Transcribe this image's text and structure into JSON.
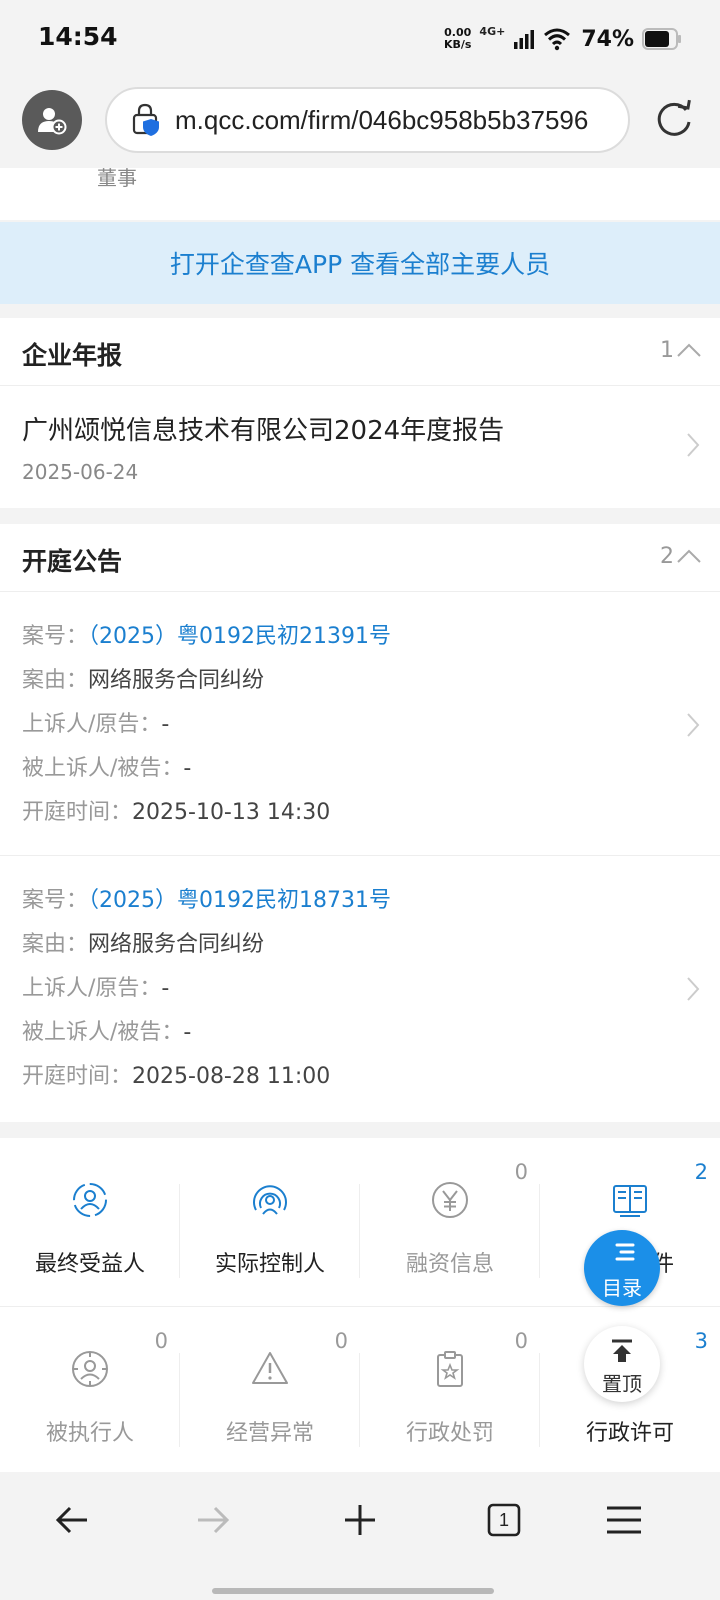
{
  "status": {
    "time": "14:54",
    "net_speed_value": "0.00",
    "net_speed_unit": "KB/s",
    "network": "4G+",
    "battery": "74%"
  },
  "browser": {
    "url": "m.qcc.com/firm/046bc958b5b37596"
  },
  "directors": {
    "role_partial": "董事",
    "banner": "打开企查查APP 查看全部主要人员"
  },
  "annual_report": {
    "title": "企业年报",
    "count": "1",
    "items": [
      {
        "title": "广州颂悦信息技术有限公司2024年度报告",
        "date": "2025-06-24"
      }
    ]
  },
  "court": {
    "title": "开庭公告",
    "count": "2",
    "labels": {
      "case_no": "案号：",
      "cause": "案由：",
      "plaintiff": "上诉人/原告：",
      "defendant": "被上诉人/被告：",
      "time": "开庭时间："
    },
    "items": [
      {
        "case_no": "（2025）粤0192民初21391号",
        "cause": "网络服务合同纠纷",
        "plaintiff": "-",
        "defendant": "-",
        "time": "2025-10-13 14:30"
      },
      {
        "case_no": "（2025）粤0192民初18731号",
        "cause": "网络服务合同纠纷",
        "plaintiff": "-",
        "defendant": "-",
        "time": "2025-08-28 11:00"
      }
    ]
  },
  "grid": {
    "row1": [
      {
        "label": "最终受益人",
        "count": "",
        "icon": "beneficiary-icon"
      },
      {
        "label": "实际控制人",
        "count": "",
        "icon": "controller-icon"
      },
      {
        "label": "融资信息",
        "count": "0",
        "icon": "yen-icon"
      },
      {
        "label": "司法案件",
        "count": "2",
        "icon": "book-icon"
      }
    ],
    "row2": [
      {
        "label": "被执行人",
        "count": "0",
        "icon": "executed-person-icon"
      },
      {
        "label": "经营异常",
        "count": "0",
        "icon": "warning-icon"
      },
      {
        "label": "行政处罚",
        "count": "0",
        "icon": "penalty-icon"
      },
      {
        "label": "行政许可",
        "count": "3",
        "icon": "license-icon"
      }
    ]
  },
  "fab": {
    "toc": "目录",
    "top": "置顶"
  },
  "bottom_nav": {
    "tab_count": "1"
  },
  "colors": {
    "accent": "#1b7fcf",
    "banner_bg": "#ddeefa",
    "fab": "#1b8fe8"
  }
}
